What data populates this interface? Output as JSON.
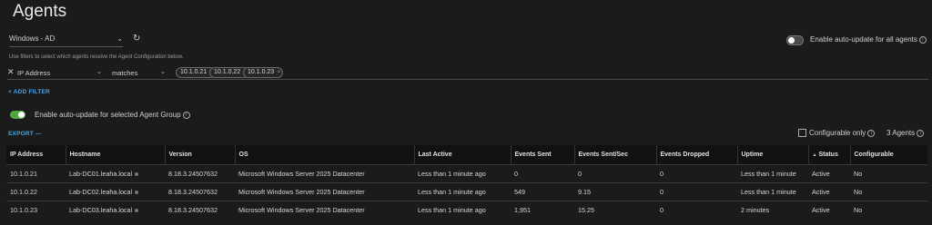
{
  "page": {
    "title": "Agents"
  },
  "config_select": {
    "value": "Windows - AD"
  },
  "global_autoupdate": {
    "label": "Enable auto-update for all agents"
  },
  "filter": {
    "hint": "Use filters to select which agents receive the Agent Configuration below.",
    "field": "IP Address",
    "operator": "matches",
    "values": [
      "10.1.0.21",
      "10.1.0.22",
      "10.1.0.23"
    ],
    "add_label": "+ ADD FILTER"
  },
  "group_autoupdate": {
    "label": "Enable auto-update for selected Agent Group"
  },
  "export_label": "EXPORT —",
  "configurable_only": {
    "label": "Configurable only"
  },
  "agent_count": "3 Agents",
  "table": {
    "headers": [
      "IP Address",
      "Hostname",
      "Version",
      "OS",
      "Last Active",
      "Events Sent",
      "Events Sent/Sec",
      "Events Dropped",
      "Uptime",
      "Status",
      "Configurable"
    ],
    "rows": [
      [
        "10.1.0.21",
        "Lab-DC01.leaha.local",
        "8.18.3.24507632",
        "Microsoft Windows Server 2025 Datacenter",
        "Less than 1 minute ago",
        "0",
        "0",
        "0",
        "Less than 1 minute",
        "Active",
        "No"
      ],
      [
        "10.1.0.22",
        "Lab-DC02.leaha.local",
        "8.18.3.24507632",
        "Microsoft Windows Server 2025 Datacenter",
        "Less than 1 minute ago",
        "549",
        "9.15",
        "0",
        "Less than 1 minute",
        "Active",
        "No"
      ],
      [
        "10.1.0.23",
        "Lab-DC03.leaha.local",
        "8.18.3.24507632",
        "Microsoft Windows Server 2025 Datacenter",
        "Less than 1 minute ago",
        "1,951",
        "15.25",
        "0",
        "2 minutes",
        "Active",
        "No"
      ]
    ]
  },
  "colors": {
    "accent": "#4aa3df",
    "toggle_on": "#51a83f",
    "background": "#1b1b1b"
  }
}
